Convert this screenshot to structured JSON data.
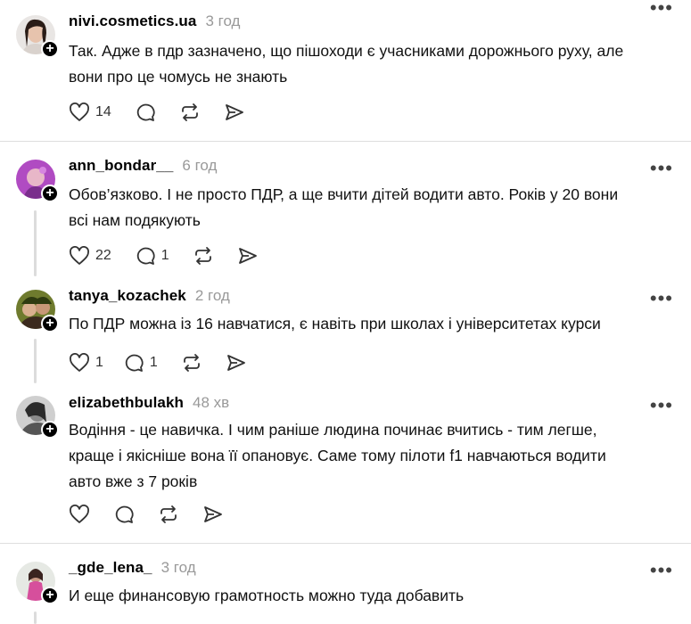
{
  "posts": [
    {
      "user": "nivi.cosmetics.ua",
      "time": "3 год",
      "lines": [
        "Так. Адже в пдр зазначено, що пішоходи є учасниками дорожнього руху, але",
        "вони про це чомусь не знають"
      ],
      "likes": "14",
      "replies": ""
    },
    {
      "user": "ann_bondar__",
      "time": "6 год",
      "lines": [
        "Обов’язково. І не просто ПДР, а ще вчити дітей водити авто. Років у 20 вони",
        "всі нам подякують"
      ],
      "likes": "22",
      "replies": "1"
    },
    {
      "user": "tanya_kozachek",
      "time": "2 год",
      "lines": [
        "По ПДР можна із 16 навчатися, є навіть при школах і університетах курси"
      ],
      "likes": "1",
      "replies": "1"
    },
    {
      "user": "elizabethbulakh",
      "time": "48 хв",
      "lines": [
        "Водіння - це навичка. І чим раніше людина починає вчитись - тим легше,",
        "краще і якісніше вона її опановує. Саме тому пілоти f1 навчаються водити",
        "авто вже з 7 років"
      ],
      "likes": "",
      "replies": ""
    },
    {
      "user": "_gde_lena_",
      "time": "3 год",
      "lines": [
        "И еще финансовую грамотность можно туда добавить"
      ],
      "likes": "",
      "replies": ""
    }
  ],
  "icons": {
    "like": "heart-icon",
    "reply": "comment-icon",
    "repost": "repost-icon",
    "share": "share-icon",
    "more": "more-icon",
    "follow": "plus-icon"
  },
  "colors": {
    "text": "#000000",
    "muted": "#999999",
    "divider": "#dedede",
    "thread": "#dcdcdc"
  }
}
